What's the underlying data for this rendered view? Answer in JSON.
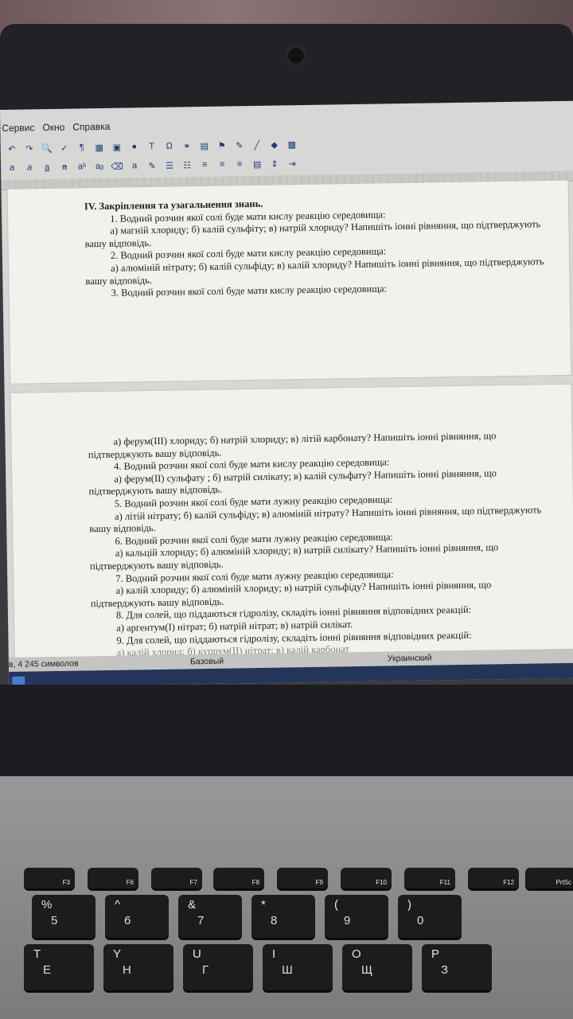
{
  "menu": [
    "Сервис",
    "Окно",
    "Справка"
  ],
  "status": {
    "count": "в, 4 245 символов",
    "style": "Базовый",
    "lang": "Украинский"
  },
  "page1": {
    "heading": "IV. Закріплення та узагальнення знань.",
    "lines": [
      "1. Водний розчин якої солі буде мати кислу реакцію середовища:",
      "а) магній хлориду; б) калій сульфіту; в) натрій хлориду? Напишіть іонні рівняння, що підтверджують вашу відповідь.",
      "2. Водний розчин якої солі буде мати кислу реакцію середовища:",
      "а) алюміній нітрату; б) калій сульфіду; в) калій хлориду? Напишіть іонні рівняння, що підтверджують вашу відповідь.",
      "3. Водний розчин якої солі буде мати кислу реакцію середовища:"
    ]
  },
  "page2": {
    "lines": [
      "а) ферум(III) хлориду; б) натрій хлориду; в) літій карбонату? Напишіть іонні рівняння, що підтверджують вашу відповідь.",
      "4. Водний розчин якої солі буде мати кислу реакцію середовища:",
      "а) ферум(II) сульфату ; б) натрій силікату; в) калій сульфату? Напишіть іонні рівняння, що підтверджують вашу відповідь.",
      "5. Водний розчин якої солі буде мати лужну реакцію середовища:",
      "а) літій нітрату; б) калій сульфіду; в) алюміній нітрату? Напишіть іонні рівняння, що підтверджують вашу відповідь.",
      "6. Водний розчин якої солі буде мати лужну реакцію середовища:",
      "а) кальцій хлориду; б) алюміній хлориду; в) натрій силікату? Напишіть іонні рівняння, що підтверджують вашу відповідь.",
      "7. Водний розчин якої солі буде мати лужну реакцію середовища:",
      "а) калій хлориду; б) алюміній хлориду; в) натрій сульфіду? Напишіть іонні рівняння, що підтверджують вашу відповідь.",
      "8. Для солей, що піддаються гідролізу, складіть іонні рівняння відповідних реакцій:",
      "а) аргентум(I) нітрат; б) натрій нітрат; в) натрій силікат.",
      "9. Для солей, що піддаються гідролізу, складіть іонні рівняння відповідних реакцій:"
    ],
    "cut": "а) калій хлорид; б) купрум(II) нітрат; в) калій карбонат"
  },
  "keys": {
    "f": [
      "F3",
      "F6",
      "F7",
      "F8",
      "F9",
      "F10",
      "F11",
      "F12",
      "PrtSc"
    ],
    "num": [
      [
        "%",
        "5"
      ],
      [
        "^",
        "6"
      ],
      [
        "&",
        "7"
      ],
      [
        "*",
        "8"
      ],
      [
        "(",
        "9"
      ],
      [
        ")",
        "0"
      ]
    ],
    "let": [
      [
        "T",
        "Е"
      ],
      [
        "Y",
        "Н"
      ],
      [
        "U",
        "Г"
      ],
      [
        "I",
        "Ш"
      ],
      [
        "O",
        "Щ"
      ],
      [
        "P",
        "З"
      ]
    ]
  }
}
